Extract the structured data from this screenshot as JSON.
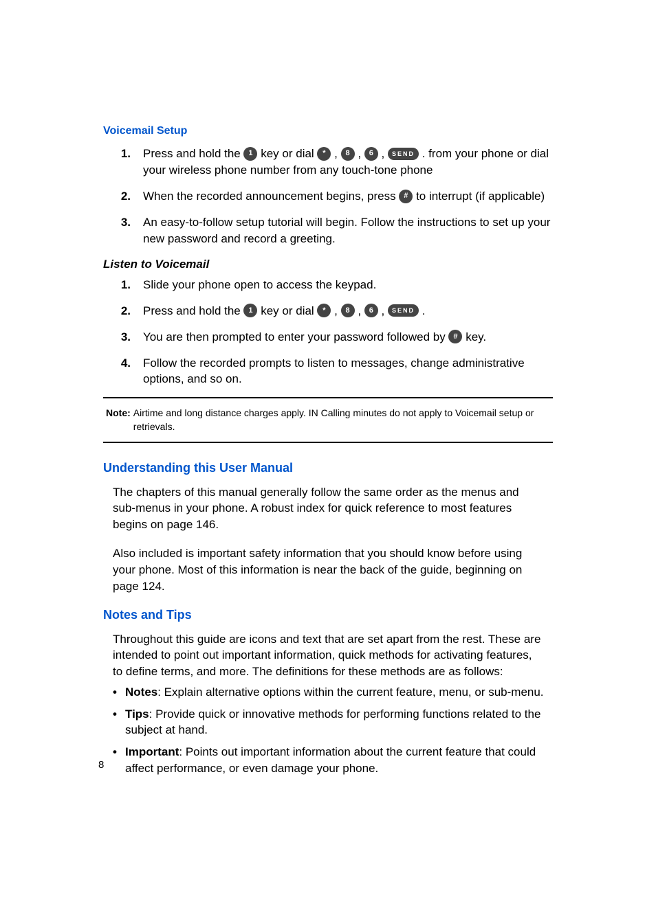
{
  "voicemail_setup": {
    "heading": "Voicemail Setup",
    "items": [
      {
        "num": "1.",
        "t1": "Press and hold the ",
        "k1": "1",
        "t2": " key or dial ",
        "k2": "*",
        "t3": ", ",
        "k3": "8",
        "t4": ", ",
        "k4": "6",
        "t5": ", ",
        "ksend": "SEND",
        "t6": ". from your phone or dial your wireless phone number from any touch-tone phone"
      },
      {
        "num": "2.",
        "t1": "When the recorded announcement begins, press ",
        "k1": "#",
        "t2": " to interrupt (if applicable)"
      },
      {
        "num": "3.",
        "t1": "An easy-to-follow setup tutorial will begin. Follow the instructions to set up your new password and record a greeting."
      }
    ]
  },
  "listen": {
    "heading": "Listen to Voicemail",
    "items": [
      {
        "num": "1.",
        "t1": "Slide your phone open to access the keypad."
      },
      {
        "num": "2.",
        "t1": "Press and hold the ",
        "k1": "1",
        "t2": " key or dial ",
        "k2": "*",
        "t3": ", ",
        "k3": "8",
        "t4": ", ",
        "k4": "6",
        "t5": ", ",
        "ksend": "SEND",
        "t6": "."
      },
      {
        "num": "3.",
        "t1": "You are then prompted to enter your password followed by ",
        "k1": "#",
        "t2": " key."
      },
      {
        "num": "4.",
        "t1": "Follow the recorded prompts to listen to messages, change administrative options, and so on."
      }
    ]
  },
  "note": {
    "label": "Note:",
    "text": "Airtime and long distance charges apply. IN Calling minutes do not apply to Voicemail setup or retrievals."
  },
  "understanding": {
    "heading": "Understanding this User Manual",
    "p1": "The chapters of this manual generally follow the same order as the menus and sub-menus in your phone. A robust index for quick reference to most features begins on page 146.",
    "p2": "Also included is important safety information that you should know before using your phone. Most of this information is near the back of the guide, beginning on page 124."
  },
  "notes_tips": {
    "heading": "Notes and Tips",
    "intro": "Throughout this guide are icons and text that are set apart from the rest. These are intended to point out important information, quick methods for activating features, to define terms, and more. The definitions for these methods are as follows:",
    "bullets": [
      {
        "term": "Notes",
        "text": ": Explain alternative options within the current feature, menu, or sub-menu."
      },
      {
        "term": "Tips",
        "text": ": Provide quick or innovative methods for performing functions related to the subject at hand."
      },
      {
        "term": "Important",
        "text": ": Points out important information about the current feature that could affect performance, or even damage your phone."
      }
    ]
  },
  "bullet_char": "•",
  "page_number": "8"
}
